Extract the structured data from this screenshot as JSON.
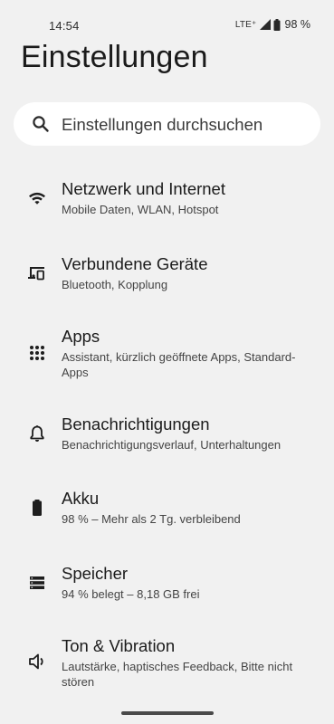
{
  "status_bar": {
    "time": "14:54",
    "network": "LTE⁺",
    "battery": "98 %"
  },
  "page": {
    "title": "Einstellungen"
  },
  "search": {
    "placeholder": "Einstellungen durchsuchen"
  },
  "settings": {
    "items": [
      {
        "icon": "wifi-icon",
        "title": "Netzwerk und Internet",
        "subtitle": "Mobile Daten, WLAN, Hotspot"
      },
      {
        "icon": "devices-icon",
        "title": "Verbundene Geräte",
        "subtitle": "Bluetooth, Kopplung"
      },
      {
        "icon": "apps-grid-icon",
        "title": "Apps",
        "subtitle": "Assistant, kürzlich geöffnete Apps, Standard-Apps"
      },
      {
        "icon": "bell-icon",
        "title": "Benachrichtigungen",
        "subtitle": "Benachrichtigungsverlauf, Unterhaltungen"
      },
      {
        "icon": "battery-icon",
        "title": "Akku",
        "subtitle": "98 % – Mehr als 2 Tg. verbleibend"
      },
      {
        "icon": "storage-icon",
        "title": "Speicher",
        "subtitle": "94 % belegt – 8,18 GB frei"
      },
      {
        "icon": "speaker-icon",
        "title": "Ton & Vibration",
        "subtitle": "Lautstärke, haptisches Feedback, Bitte nicht stören"
      }
    ]
  }
}
